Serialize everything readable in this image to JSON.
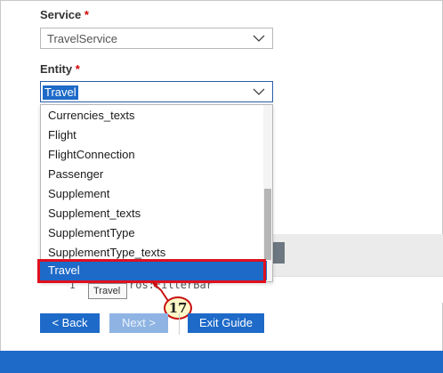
{
  "service": {
    "label": "Service",
    "required_mark": "*",
    "value": "TravelService"
  },
  "entity": {
    "label": "Entity",
    "required_mark": "*",
    "value": "Travel"
  },
  "dropdown": {
    "items": [
      "Currencies_texts",
      "Flight",
      "FlightConnection",
      "Passenger",
      "Supplement",
      "Supplement_texts",
      "SupplementType",
      "SupplementType_texts"
    ],
    "selected": "Travel"
  },
  "tooltip": "Travel",
  "code": {
    "line_number": "1",
    "text": "ros:FilterBar"
  },
  "callout": "17",
  "buttons": {
    "back": "< Back",
    "next": "Next >",
    "exit": "Exit Guide"
  },
  "colors": {
    "accent": "#1e6ac8",
    "highlight": "#e0101e",
    "callout_fill": "#fff8c8"
  }
}
